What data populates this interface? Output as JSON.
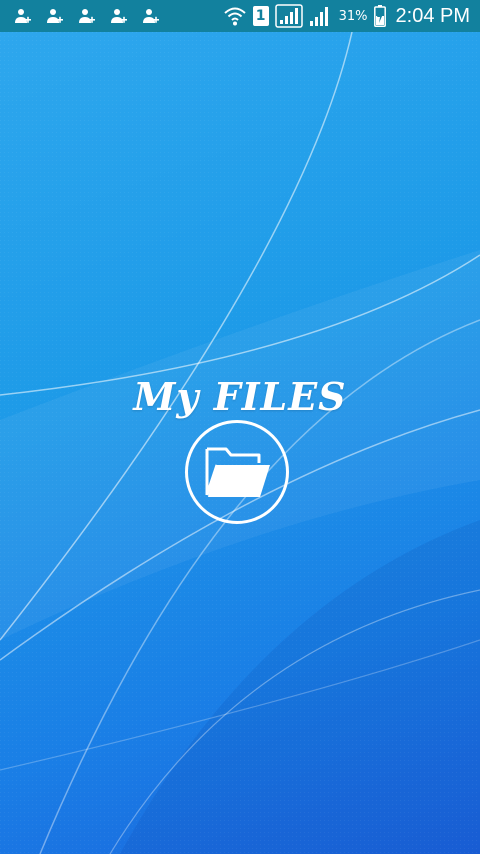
{
  "status_bar": {
    "notification_icons": [
      "person-add-icon",
      "person-add-icon",
      "person-add-icon",
      "person-add-icon",
      "person-add-icon"
    ],
    "sim_label": "1",
    "battery_percent": "31%",
    "time": "2:04 PM"
  },
  "splash": {
    "title": "My FILES",
    "logo_icon": "folder-open-icon"
  },
  "colors": {
    "status_bar_bg": "#12819e",
    "background_top": "#2fa8ee",
    "background_bottom": "#1b63dc",
    "foreground": "#ffffff"
  }
}
